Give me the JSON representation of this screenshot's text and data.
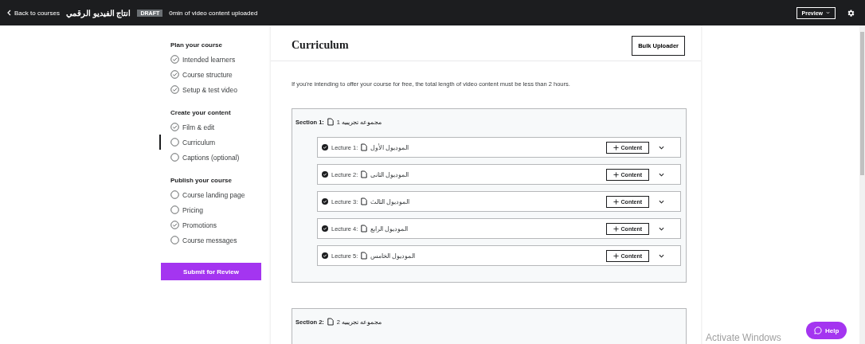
{
  "top_bar": {
    "back_link": "Back to courses",
    "course_title": "انتاج الفيديو الرقمي",
    "status_badge": "DRAFT",
    "upload_status": "0min of video content uploaded",
    "preview_button": "Preview"
  },
  "sidebar": {
    "groups": [
      {
        "title": "Plan your course",
        "items": [
          {
            "label": "Intended learners",
            "checked": true,
            "selected": false
          },
          {
            "label": "Course structure",
            "checked": true,
            "selected": false
          },
          {
            "label": "Setup & test video",
            "checked": true,
            "selected": false
          }
        ]
      },
      {
        "title": "Create your content",
        "items": [
          {
            "label": "Film & edit",
            "checked": true,
            "selected": false
          },
          {
            "label": "Curriculum",
            "checked": false,
            "selected": true
          },
          {
            "label": "Captions (optional)",
            "checked": false,
            "selected": false
          }
        ]
      },
      {
        "title": "Publish your course",
        "items": [
          {
            "label": "Course landing page",
            "checked": false,
            "selected": false
          },
          {
            "label": "Pricing",
            "checked": false,
            "selected": false
          },
          {
            "label": "Promotions",
            "checked": true,
            "selected": false
          },
          {
            "label": "Course messages",
            "checked": false,
            "selected": false
          }
        ]
      }
    ],
    "submit_button": "Submit for Review"
  },
  "main": {
    "title": "Curriculum",
    "bulk_button": "Bulk Uploader",
    "notice": "If you're intending to offer your course for free, the total length of video content must be less than 2 hours.",
    "sections": [
      {
        "label": "Section 1:",
        "title": "مجموعه تجريبيه 1",
        "lectures": [
          {
            "label": "Lecture 1:",
            "title": "الموديول الأول",
            "button": "Content"
          },
          {
            "label": "Lecture 2:",
            "title": "الموديول الثانى",
            "button": "Content"
          },
          {
            "label": "Lecture 3:",
            "title": "الموديول الثالث",
            "button": "Content"
          },
          {
            "label": "Lecture 4:",
            "title": "الموديول الرابع",
            "button": "Content"
          },
          {
            "label": "Lecture 5:",
            "title": "الموديول الخامس",
            "button": "Content"
          }
        ]
      },
      {
        "label": "Section 2:",
        "title": "مجموعه تجريبيه 2"
      }
    ]
  },
  "os_overlay": "Activate Windows",
  "help_button": "Help"
}
